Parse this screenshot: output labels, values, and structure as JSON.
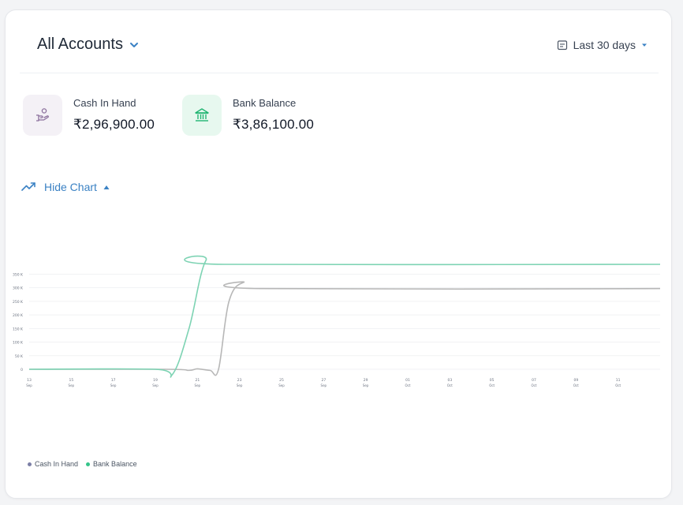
{
  "header": {
    "title": "All Accounts",
    "date_range": "Last 30 days"
  },
  "stats": [
    {
      "label": "Cash In Hand",
      "value": "₹2,96,900.00",
      "icon": "hand-coin-icon"
    },
    {
      "label": "Bank Balance",
      "value": "₹3,86,100.00",
      "icon": "bank-icon"
    }
  ],
  "chart_toggle": {
    "label": "Hide Chart"
  },
  "colors": {
    "accent": "#3b82c4",
    "cash_line": "#b7b7b7",
    "bank_line": "#7dd3b3",
    "cash_legend": "#7c7fa6",
    "bank_legend": "#34c48a"
  },
  "chart_data": {
    "type": "line",
    "categories": [
      "13 Sep",
      "15 Sep",
      "17 Sep",
      "19 Sep",
      "21 Sep",
      "23 Sep",
      "25 Sep",
      "27 Sep",
      "29 Sep",
      "01 Oct",
      "03 Oct",
      "05 Oct",
      "07 Oct",
      "09 Oct",
      "11 Oct"
    ],
    "y_tick_labels": [
      "0",
      "50 K",
      "100 K",
      "150 K",
      "200 K",
      "250 K",
      "300 K",
      "350 K"
    ],
    "ylim": [
      0,
      450000
    ],
    "xlim": [
      13,
      43
    ],
    "series": [
      {
        "name": "Cash In Hand",
        "points": [
          [
            13,
            0
          ],
          [
            19.5,
            0
          ],
          [
            20.6,
            -4000
          ],
          [
            21,
            1500
          ],
          [
            21.6,
            -4000
          ],
          [
            22,
            -1000
          ],
          [
            22.5,
            250000
          ],
          [
            23.2,
            320000
          ],
          [
            24,
            296900
          ],
          [
            43,
            296900
          ]
        ]
      },
      {
        "name": "Bank Balance",
        "points": [
          [
            13,
            0
          ],
          [
            19,
            0
          ],
          [
            19.8,
            -20000
          ],
          [
            20.6,
            150000
          ],
          [
            21.4,
            400000
          ],
          [
            22.3,
            386100
          ],
          [
            43,
            386100
          ]
        ]
      }
    ],
    "legend_position": "bottom-left",
    "grid": true
  }
}
